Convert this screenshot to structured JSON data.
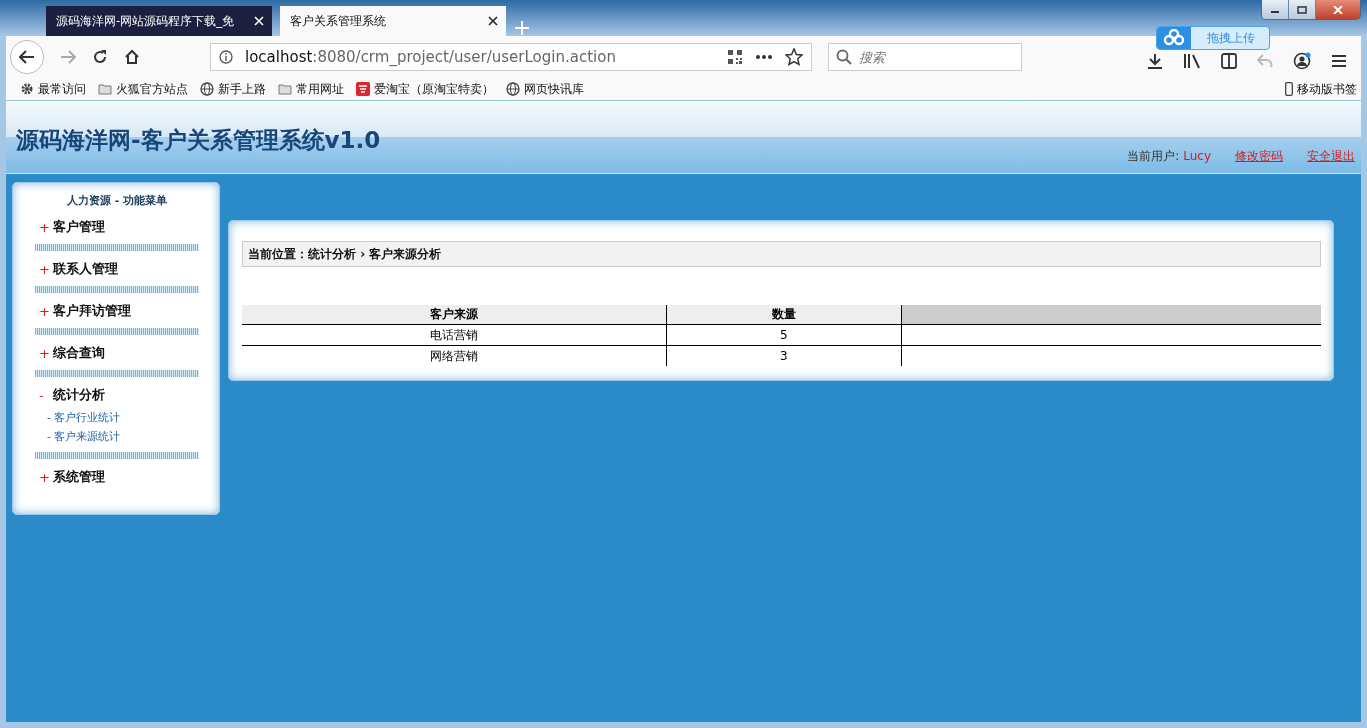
{
  "browser": {
    "tabs": [
      {
        "title": "源码海洋网-网站源码程序下载_免",
        "selected": false
      },
      {
        "title": "客户关系管理系统",
        "selected": true
      }
    ],
    "address": {
      "host": "localhost",
      "path": ":8080/crm_project/user/userLogin.action"
    },
    "search": {
      "placeholder": "搜索"
    },
    "upload_badge": "拖拽上传",
    "bookmarks": [
      {
        "kind": "gear",
        "label": "最常访问"
      },
      {
        "kind": "folder",
        "label": "火狐官方站点"
      },
      {
        "kind": "globe",
        "label": "新手上路"
      },
      {
        "kind": "folder",
        "label": "常用网址"
      },
      {
        "kind": "taobao",
        "label": "爱淘宝（原淘宝特卖）"
      },
      {
        "kind": "globe",
        "label": "网页快讯库"
      }
    ],
    "mobile_bookmarks": "移动版书签"
  },
  "header": {
    "title": "源码海洋网-客户关系管理系统v1.0",
    "user_label": "当前用户:",
    "user_name": "Lucy",
    "links": [
      "修改密码",
      "安全退出"
    ]
  },
  "sidebar": {
    "title": "人力资源  - 功能菜单",
    "items": [
      {
        "sign": "+",
        "label": "客户管理",
        "expanded": false
      },
      {
        "sign": "+",
        "label": "联系人管理",
        "expanded": false
      },
      {
        "sign": "+",
        "label": "客户拜访管理",
        "expanded": false
      },
      {
        "sign": "+",
        "label": "综合查询",
        "expanded": false
      },
      {
        "sign": "-",
        "label": "统计分析",
        "expanded": true,
        "children": [
          "- 客户行业统计",
          "- 客户来源统计"
        ]
      },
      {
        "sign": "+",
        "label": "系统管理",
        "expanded": false
      }
    ]
  },
  "breadcrumb": {
    "label": "当前位置：",
    "path": [
      "统计分析",
      "客户来源分析"
    ],
    "separator": "›"
  },
  "table": {
    "columns": [
      "客户来源",
      "数量"
    ],
    "rows": [
      [
        "电话营销",
        "5"
      ],
      [
        "网络营销",
        "3"
      ]
    ]
  }
}
